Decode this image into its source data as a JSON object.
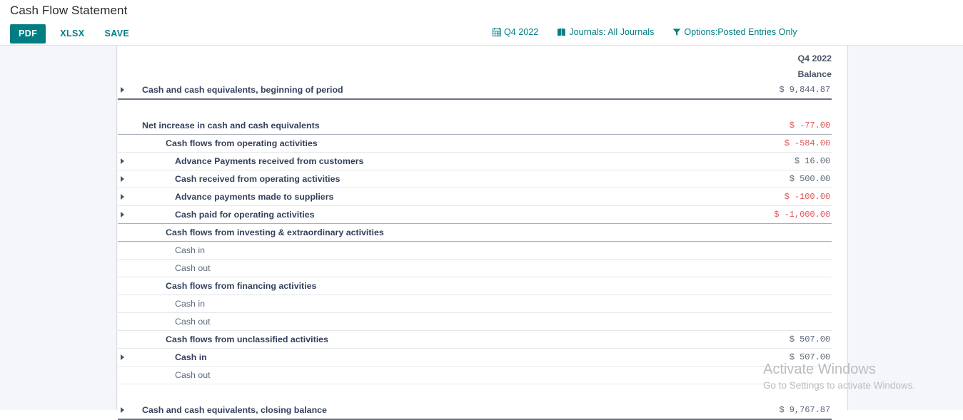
{
  "header": {
    "title": "Cash Flow Statement",
    "buttons": [
      {
        "label": "PDF",
        "name": "pdf-button"
      },
      {
        "label": "XLSX",
        "name": "xlsx-button"
      },
      {
        "label": "SAVE",
        "name": "save-button"
      }
    ],
    "accent_color": "#017e84",
    "filters": [
      {
        "icon": "calendar-icon",
        "label": "Q4 2022"
      },
      {
        "icon": "book-icon",
        "label": "Journals: All Journals"
      },
      {
        "icon": "funnel-icon",
        "label": "Options:Posted Entries Only"
      }
    ]
  },
  "table": {
    "column_header_period": "Q4 2022",
    "column_header_measure": "Balance",
    "negative_color": "#e0575c",
    "rows": [
      {
        "label": "Cash and cash equivalents, beginning of period",
        "value": "$ 9,844.87",
        "caret": true,
        "style": "lvl-total",
        "sep": "sep-heavy",
        "negative": false
      },
      {
        "label": "",
        "value": "",
        "caret": false,
        "style": "spacer",
        "sep": "sep-none",
        "negative": false
      },
      {
        "label": "Net increase in cash and cash equivalents",
        "value": "$ -77.00",
        "caret": false,
        "style": "lvl-1",
        "sep": "sep-med",
        "negative": true
      },
      {
        "label": "Cash flows from operating activities",
        "value": "$ -584.00",
        "caret": false,
        "style": "lvl-2",
        "sep": "sep-light",
        "negative": true
      },
      {
        "label": "Advance Payments received from customers",
        "value": "$ 16.00",
        "caret": true,
        "style": "lvl-3",
        "sep": "sep-light",
        "negative": false
      },
      {
        "label": "Cash received from operating activities",
        "value": "$ 500.00",
        "caret": true,
        "style": "lvl-3",
        "sep": "sep-light",
        "negative": false
      },
      {
        "label": "Advance payments made to suppliers",
        "value": "$ -100.00",
        "caret": true,
        "style": "lvl-3",
        "sep": "sep-light",
        "negative": true
      },
      {
        "label": "Cash paid for operating activities",
        "value": "$ -1,000.00",
        "caret": true,
        "style": "lvl-3",
        "sep": "sep-med",
        "negative": true
      },
      {
        "label": "Cash flows from investing & extraordinary activities",
        "value": "",
        "caret": false,
        "style": "lvl-2",
        "sep": "sep-med",
        "negative": false
      },
      {
        "label": "Cash in",
        "value": "",
        "caret": false,
        "style": "lvl-leaf",
        "sep": "sep-light",
        "negative": false
      },
      {
        "label": "Cash out",
        "value": "",
        "caret": false,
        "style": "lvl-leaf",
        "sep": "sep-light",
        "negative": false
      },
      {
        "label": "Cash flows from financing activities",
        "value": "",
        "caret": false,
        "style": "lvl-2",
        "sep": "sep-light",
        "negative": false
      },
      {
        "label": "Cash in",
        "value": "",
        "caret": false,
        "style": "lvl-leaf",
        "sep": "sep-light",
        "negative": false
      },
      {
        "label": "Cash out",
        "value": "",
        "caret": false,
        "style": "lvl-leaf",
        "sep": "sep-light",
        "negative": false
      },
      {
        "label": "Cash flows from unclassified activities",
        "value": "$ 507.00",
        "caret": false,
        "style": "lvl-2",
        "sep": "sep-light",
        "negative": false
      },
      {
        "label": "Cash in",
        "value": "$ 507.00",
        "caret": true,
        "style": "lvl-3",
        "sep": "sep-light",
        "negative": false
      },
      {
        "label": "Cash out",
        "value": "",
        "caret": false,
        "style": "lvl-leaf",
        "sep": "sep-light",
        "negative": false
      },
      {
        "label": "",
        "value": "",
        "caret": false,
        "style": "spacer",
        "sep": "sep-none",
        "negative": false
      },
      {
        "label": "Cash and cash equivalents, closing balance",
        "value": "$ 9,767.87",
        "caret": true,
        "style": "lvl-total",
        "sep": "sep-heavy",
        "negative": false
      }
    ]
  },
  "watermark": {
    "title": "Activate Windows",
    "subtitle": "Go to Settings to activate Windows."
  }
}
